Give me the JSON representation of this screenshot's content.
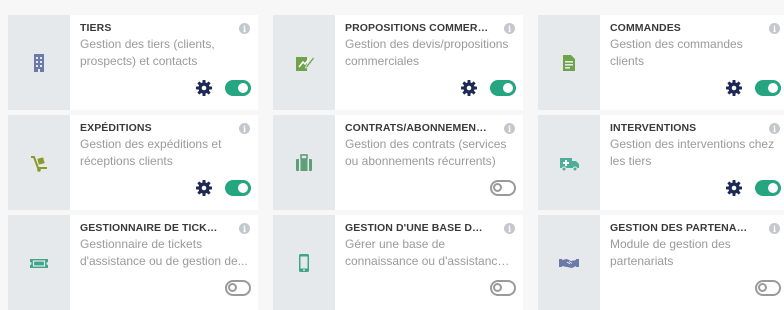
{
  "modules": [
    {
      "title": "TIERS",
      "desc_lines": [
        "Gestion des tiers (clients,",
        "prospects) et contacts"
      ],
      "icon": "building-icon",
      "icon_color": "#6b7aa8",
      "enabled": true,
      "has_settings": true
    },
    {
      "title": "PROPOSITIONS COMMERCIALES",
      "desc_lines": [
        "Gestion des devis/propositions",
        "commerciales"
      ],
      "icon": "document-pen-icon",
      "icon_color": "#6fa34a",
      "enabled": true,
      "has_settings": true
    },
    {
      "title": "COMMANDES",
      "desc_lines": [
        "Gestion des commandes clients"
      ],
      "icon": "order-document-icon",
      "icon_color": "#6fa34a",
      "enabled": true,
      "has_settings": true
    },
    {
      "title": "EXPÉDITIONS",
      "desc_lines": [
        "Gestion des expéditions et",
        "réceptions clients"
      ],
      "icon": "dolly-icon",
      "icon_color": "#8a9a2a",
      "enabled": true,
      "has_settings": true
    },
    {
      "title": "CONTRATS/ABONNEMENTS",
      "desc_lines": [
        "Gestion des contrats (services",
        "ou abonnements récurrents)"
      ],
      "icon": "suitcase-icon",
      "icon_color": "#5f9e78",
      "enabled": false,
      "has_settings": false
    },
    {
      "title": "INTERVENTIONS",
      "desc_lines": [
        "Gestion des interventions chez",
        "les tiers"
      ],
      "icon": "ambulance-icon",
      "icon_color": "#4fae9a",
      "enabled": true,
      "has_settings": true
    },
    {
      "title": "GESTIONNAIRE DE TICKETS",
      "desc_lines": [
        "Gestionnaire de tickets",
        "d'assistance ou de gestion de..."
      ],
      "icon": "ticket-icon",
      "icon_color": "#3fa58a",
      "enabled": false,
      "has_settings": false
    },
    {
      "title": "GESTION D'UNE BASE DE CON...",
      "desc_lines": [
        "Gérer une base de",
        "connaissance ou d'assistance..."
      ],
      "icon": "mobile-icon",
      "icon_color": "#3fa58a",
      "enabled": false,
      "has_settings": false
    },
    {
      "title": "GESTION DES PARTENARIATS",
      "desc_lines": [
        "Module de gestion des",
        "partenariats"
      ],
      "icon": "handshake-icon",
      "icon_color": "#6b7aa8",
      "enabled": false,
      "has_settings": false
    }
  ],
  "colors": {
    "toggle_on": "#25a580",
    "gear": "#1e2a55",
    "info_badge": "#c4c8cc"
  },
  "info_glyph": "i"
}
